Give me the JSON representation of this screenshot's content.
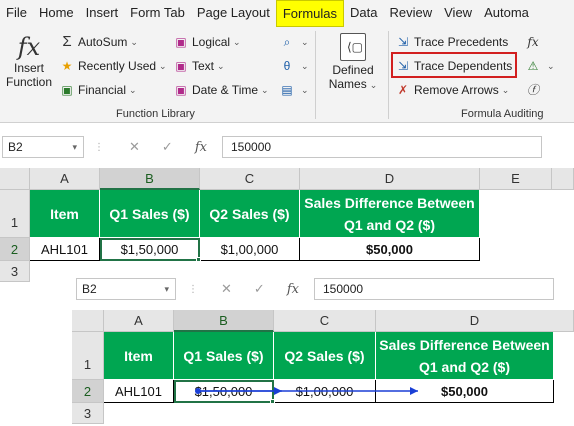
{
  "menu": {
    "tabs": [
      "File",
      "Home",
      "Insert",
      "Form Tab",
      "Page Layout",
      "Formulas",
      "Data",
      "Review",
      "View",
      "Automa"
    ]
  },
  "ribbon": {
    "insert_function": {
      "line1": "Insert",
      "line2": "Function"
    },
    "autosum": "AutoSum",
    "recently_used": "Recently Used",
    "financial": "Financial",
    "logical": "Logical",
    "text": "Text",
    "date_time": "Date & Time",
    "defined_names": {
      "line1": "Defined",
      "line2": "Names"
    },
    "trace_precedents": "Trace Precedents",
    "trace_dependents": "Trace Dependents",
    "remove_arrows": "Remove Arrows",
    "function_library_label": "Function Library",
    "formula_auditing_label": "Formula Auditing",
    "highlight_color": "#d21f1f",
    "tab_highlight_color": "#ffff00"
  },
  "sheet1": {
    "name_box": "B2",
    "formula_value": "150000",
    "columns": [
      "A",
      "B",
      "C",
      "D",
      "E"
    ],
    "rows": [
      "1",
      "2",
      "3"
    ],
    "headers": [
      "Item",
      "Q1 Sales ($)",
      "Q2 Sales ($)",
      "Sales Difference Between Q1 and Q2 ($)"
    ],
    "values": [
      "AHL101",
      "$1,50,000",
      "$1,00,000",
      "$50,000"
    ]
  },
  "sheet2": {
    "name_box": "B2",
    "formula_value": "150000",
    "columns": [
      "A",
      "B",
      "C",
      "D"
    ],
    "rows": [
      "1",
      "2",
      "3"
    ],
    "headers": [
      "Item",
      "Q1 Sales ($)",
      "Q2 Sales ($)",
      "Sales Difference Between Q1 and Q2 ($)"
    ],
    "values": [
      "AHL101",
      "$1,50,000",
      "$1,00,000",
      "$50,000"
    ]
  },
  "colors": {
    "header_fill": "#00a651",
    "selection": "#217346",
    "tracer_arrow": "#1a3fd6"
  },
  "icons": {
    "fx": "fx",
    "cancel": "✕",
    "enter": "✓"
  }
}
